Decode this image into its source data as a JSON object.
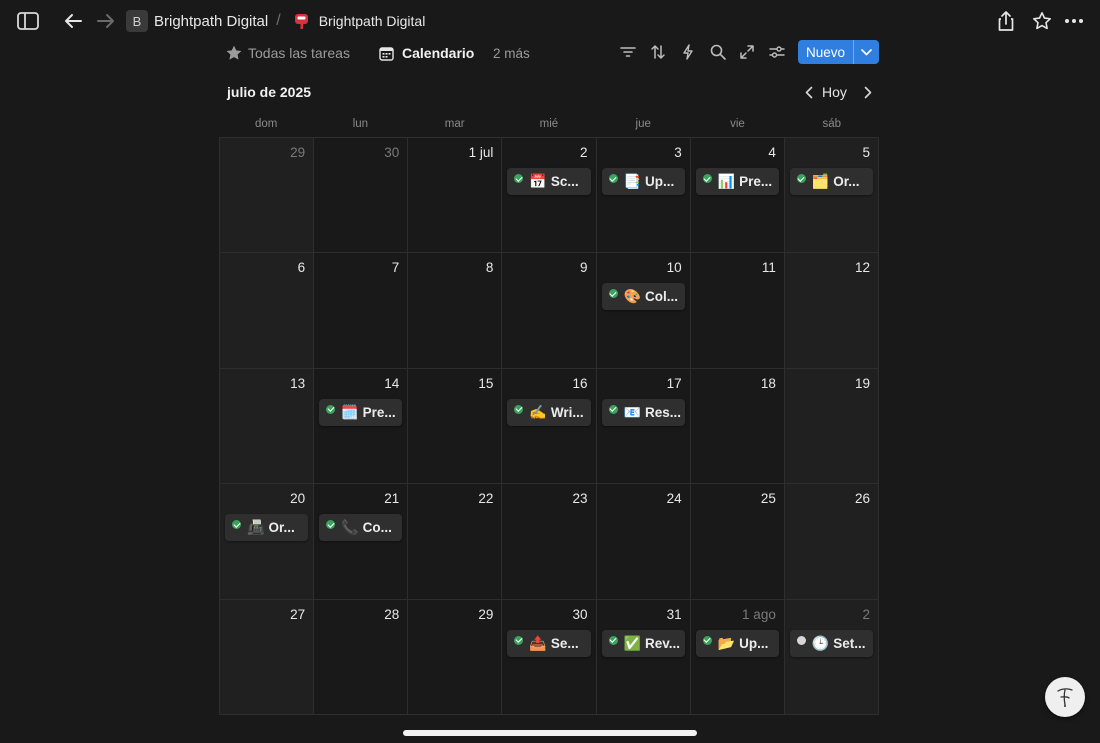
{
  "topbar": {
    "workspace_initial": "B",
    "workspace_name": "Brightpath Digital",
    "separator": "/",
    "page_title": "Brightpath Digital",
    "icons": [
      "sidebar-toggle-icon",
      "back-arrow-icon",
      "forward-arrow-icon",
      "share-icon",
      "star-icon",
      "more-icon"
    ]
  },
  "views": {
    "all_tasks": "Todas las tareas",
    "calendar": "Calendario",
    "more": "2 más",
    "new_button": "Nuevo",
    "tools": [
      "filter-icon",
      "sort-icon",
      "automation-icon",
      "search-icon",
      "expand-icon",
      "settings-icon"
    ]
  },
  "calendar": {
    "month_label": "julio de 2025",
    "today_label": "Hoy",
    "weekdays": [
      "dom",
      "lun",
      "mar",
      "mié",
      "jue",
      "vie",
      "sáb"
    ],
    "weeks": [
      [
        {
          "day": "29",
          "muted": true
        },
        {
          "day": "30",
          "muted": true
        },
        {
          "day": "1 jul"
        },
        {
          "day": "2",
          "task": {
            "emoji": "📅",
            "title": "Sc..."
          }
        },
        {
          "day": "3",
          "task": {
            "emoji": "📑",
            "title": "Up..."
          }
        },
        {
          "day": "4",
          "task": {
            "emoji": "📊",
            "title": "Pre..."
          }
        },
        {
          "day": "5",
          "task": {
            "emoji": "🗂️",
            "title": "Or..."
          }
        }
      ],
      [
        {
          "day": "6"
        },
        {
          "day": "7"
        },
        {
          "day": "8"
        },
        {
          "day": "9"
        },
        {
          "day": "10",
          "task": {
            "emoji": "🎨",
            "title": "Col..."
          }
        },
        {
          "day": "11"
        },
        {
          "day": "12"
        }
      ],
      [
        {
          "day": "13"
        },
        {
          "day": "14",
          "task": {
            "emoji": "🗓️",
            "title": "Pre..."
          }
        },
        {
          "day": "15"
        },
        {
          "day": "16",
          "task": {
            "emoji": "✍️",
            "title": "Wri..."
          }
        },
        {
          "day": "17",
          "task": {
            "emoji": "📧",
            "title": "Res..."
          }
        },
        {
          "day": "18"
        },
        {
          "day": "19"
        }
      ],
      [
        {
          "day": "20",
          "task": {
            "emoji": "📠",
            "title": "Or..."
          }
        },
        {
          "day": "21",
          "task": {
            "emoji": "📞",
            "title": "Co..."
          }
        },
        {
          "day": "22"
        },
        {
          "day": "23"
        },
        {
          "day": "24"
        },
        {
          "day": "25"
        },
        {
          "day": "26"
        }
      ],
      [
        {
          "day": "27"
        },
        {
          "day": "28"
        },
        {
          "day": "29"
        },
        {
          "day": "30",
          "task": {
            "emoji": "📤",
            "title": "Se..."
          }
        },
        {
          "day": "31",
          "task": {
            "emoji": "✅",
            "title": "Rev..."
          }
        },
        {
          "day": "1 ago",
          "muted": true,
          "task": {
            "emoji": "📂",
            "title": "Up..."
          }
        },
        {
          "day": "2",
          "muted": true,
          "task": {
            "emoji": "🕒",
            "title": "Set...",
            "status": "gray"
          }
        }
      ]
    ]
  },
  "colors": {
    "background": "#191919",
    "weekend_cell": "#202020",
    "accent": "#2f7ee0",
    "done_check": "#3aa35c"
  }
}
